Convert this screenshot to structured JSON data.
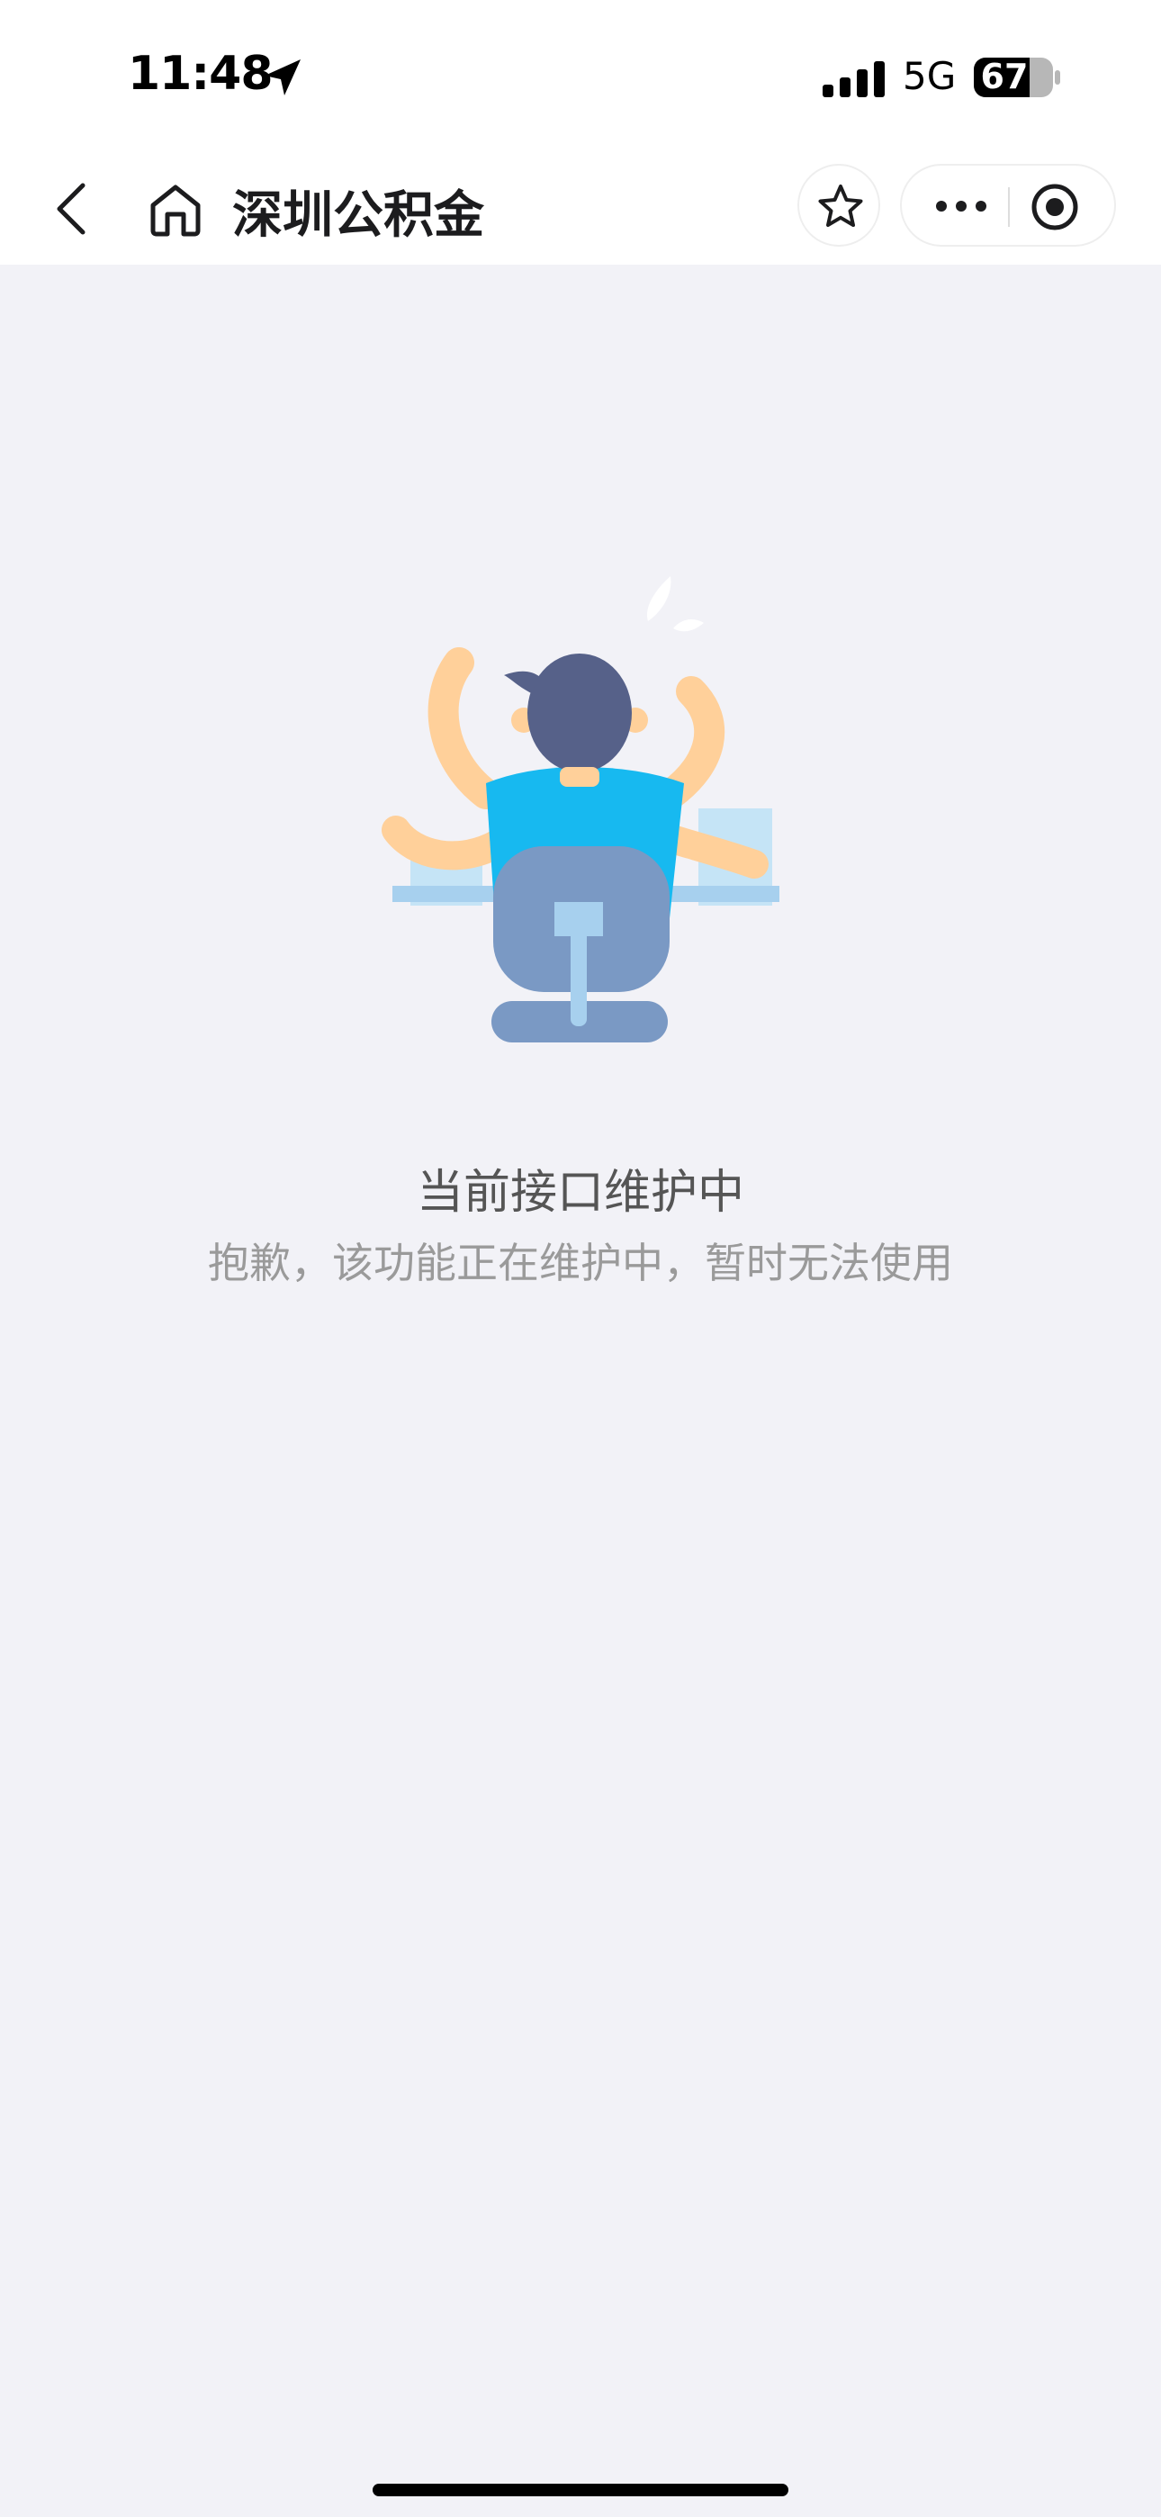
{
  "status_bar": {
    "time": "11:48",
    "network": "5G",
    "battery": "67"
  },
  "nav": {
    "title": "深圳公积金"
  },
  "message": {
    "title": "当前接口维护中",
    "body": "抱歉，该功能正在维护中，暂时无法使用"
  },
  "icons": {
    "location": "location-arrow-icon",
    "signal": "signal-icon",
    "battery": "battery-icon",
    "back": "chevron-left-icon",
    "home": "home-icon",
    "favorite": "star-icon",
    "more": "more-dots-icon",
    "close": "target-close-icon",
    "illustration": "maintenance-worker-illustration"
  },
  "colors": {
    "background": "#f2f2f7",
    "shirt": "#17b9f0",
    "hair": "#566189",
    "skin": "#ffd09a",
    "chair": "#7a99c4"
  }
}
